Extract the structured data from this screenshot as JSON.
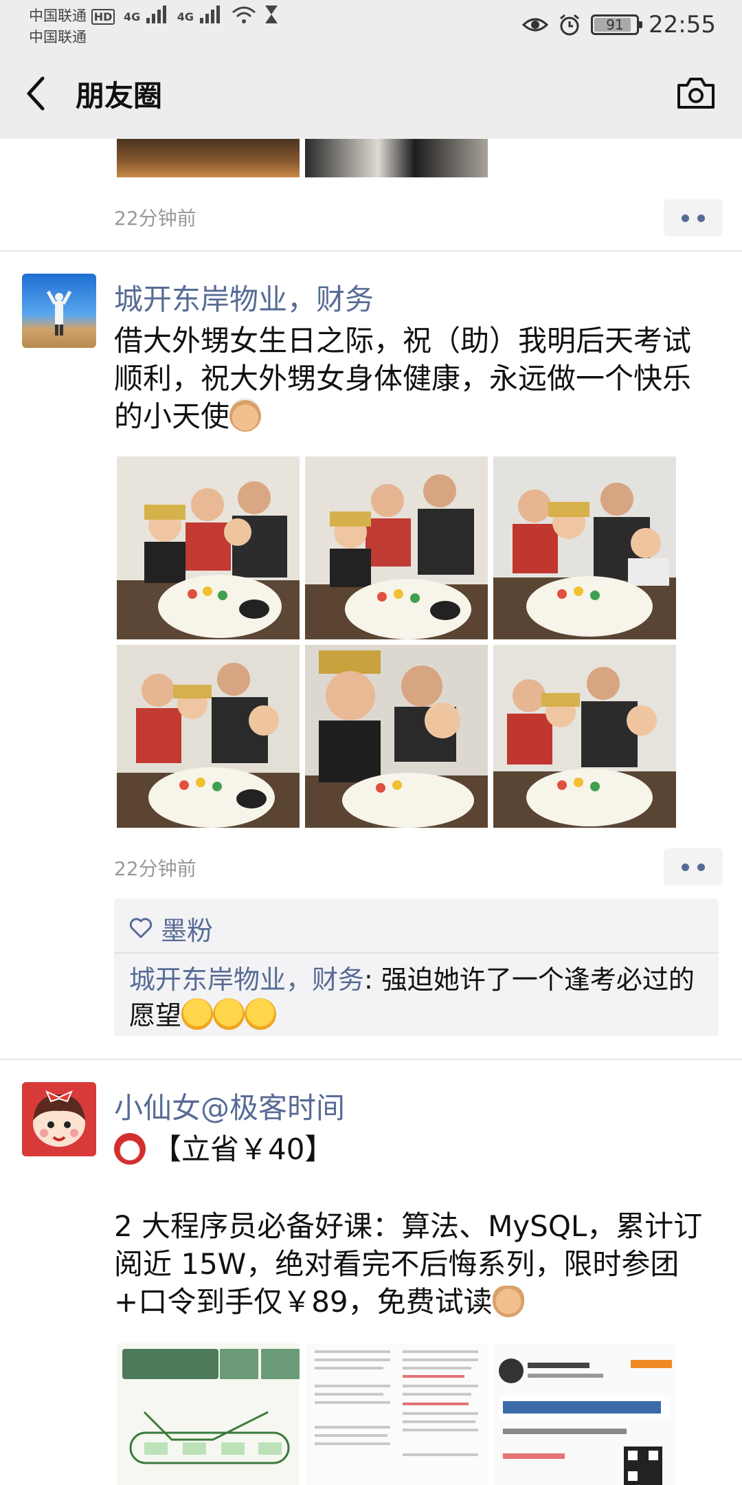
{
  "statusbar": {
    "carrier_line1": "中国联通",
    "hd_badge": "HD",
    "net1": "4G",
    "net2": "4G",
    "carrier_line2": "中国联通",
    "battery": "91",
    "time": "22:55"
  },
  "nav": {
    "title": "朋友圈"
  },
  "prev_post": {
    "time": "22分钟前"
  },
  "post1": {
    "author": "城开东岸物业，财务",
    "text": "借大外甥女生日之际，祝（助）我明后天考试顺利，祝大外甥女身体健康，永远做一个快乐的小天使",
    "time": "22分钟前",
    "likes": {
      "users": "墨粉"
    },
    "comments": [
      {
        "author": "城开东岸物业，财务",
        "separator": ": ",
        "text": "强迫她许了一个逢考必过的愿望"
      }
    ]
  },
  "post2": {
    "author": "小仙女@极客时间",
    "line1": "【立省￥40】",
    "text": "2 大程序员必备好课：算法、MySQL，累计订阅近 15W，绝对看完不后悔系列，限时参团+口令到手仅￥89，免费试读"
  },
  "colors": {
    "link": "#576b95",
    "background": "#ededed"
  },
  "icons": [
    "back-arrow-icon",
    "camera-icon",
    "heart-icon",
    "alarm-clock-emoji",
    "angel-emoji",
    "crying-laughing-emoji",
    "pointing-down-emoji"
  ]
}
